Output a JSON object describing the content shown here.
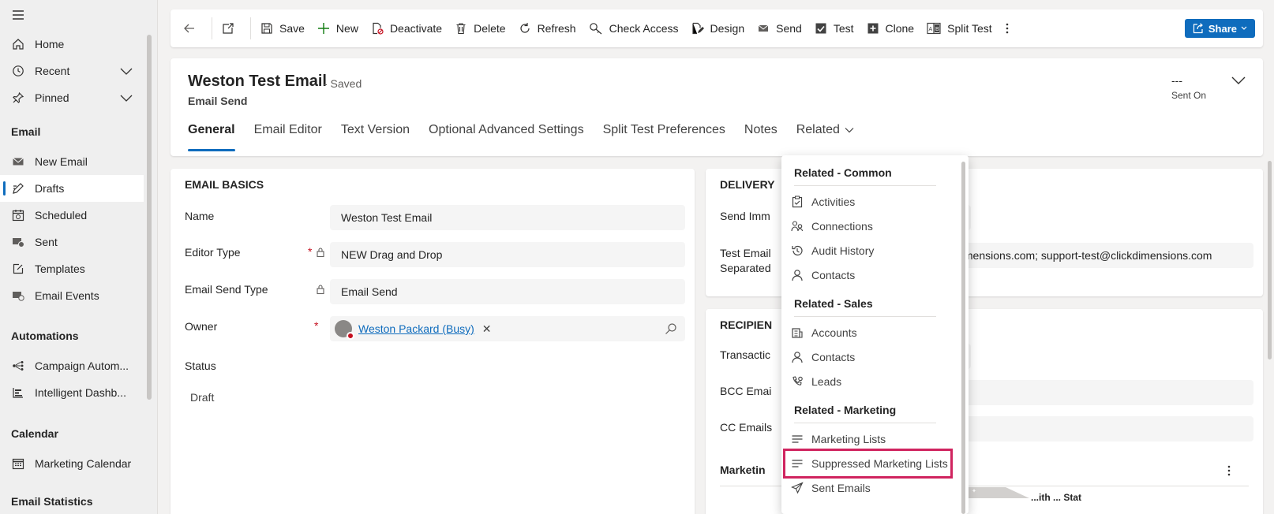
{
  "sidebar": {
    "nav": [
      {
        "label": "Home",
        "icon": "home-icon"
      },
      {
        "label": "Recent",
        "icon": "clock-icon"
      },
      {
        "label": "Pinned",
        "icon": "pin-icon"
      }
    ],
    "sections": [
      {
        "title": "Email",
        "items": [
          {
            "label": "New Email",
            "icon": "envelope-icon"
          },
          {
            "label": "Drafts",
            "icon": "pencil-icon"
          },
          {
            "label": "Scheduled",
            "icon": "calendar-clock-icon"
          },
          {
            "label": "Sent",
            "icon": "sent-icon"
          },
          {
            "label": "Templates",
            "icon": "template-icon"
          },
          {
            "label": "Email Events",
            "icon": "events-icon"
          }
        ]
      },
      {
        "title": "Automations",
        "items": [
          {
            "label": "Campaign Autom...",
            "icon": "flow-icon"
          },
          {
            "label": "Intelligent Dashb...",
            "icon": "dashboard-icon"
          }
        ]
      },
      {
        "title": "Calendar",
        "items": [
          {
            "label": "Marketing Calendar",
            "icon": "calendar-icon"
          }
        ]
      },
      {
        "title": "Email Statistics",
        "items": []
      }
    ],
    "active_item": "Drafts"
  },
  "toolbar": {
    "buttons": [
      "Save",
      "New",
      "Deactivate",
      "Delete",
      "Refresh",
      "Check Access",
      "Design",
      "Send",
      "Test",
      "Clone",
      "Split Test"
    ],
    "share_label": "Share"
  },
  "record": {
    "title": "Weston Test Email",
    "saved_status": "- Saved",
    "entity": "Email Send",
    "sent_on_value": "---",
    "sent_on_label": "Sent On"
  },
  "tabs": [
    "General",
    "Email Editor",
    "Text Version",
    "Optional Advanced Settings",
    "Split Test Preferences",
    "Notes",
    "Related"
  ],
  "basics": {
    "title": "EMAIL BASICS",
    "name_label": "Name",
    "name_value": "Weston Test Email",
    "editor_label": "Editor Type",
    "editor_value": "NEW Drag and Drop",
    "send_type_label": "Email Send Type",
    "send_type_value": "Email Send",
    "owner_label": "Owner",
    "owner_value": "Weston Packard (Busy)",
    "status_label": "Status",
    "status_value": "Draft",
    "required_mark": "*"
  },
  "delivery": {
    "title": "DELIVERY",
    "send_imm_label": "Send Imm",
    "test_email_label": "Test Email",
    "separated_label": "Separated",
    "test_email_value": "ckdimensions.com; support-test@clickdimensions.com"
  },
  "recipients": {
    "title": "RECIPIEN",
    "transaction_label": "Transactic",
    "bcc_label": "BCC Emai",
    "cc_label": "CC Emails",
    "marketing_label": "Marketin",
    "partial_header": "...ith ... Stat"
  },
  "related_menu": {
    "groups": [
      {
        "title": "Related - Common",
        "items": [
          "Activities",
          "Connections",
          "Audit History",
          "Contacts"
        ]
      },
      {
        "title": "Related - Sales",
        "items": [
          "Accounts",
          "Contacts",
          "Leads"
        ]
      },
      {
        "title": "Related - Marketing",
        "items": [
          "Marketing Lists",
          "Suppressed Marketing Lists",
          "Sent Emails"
        ]
      }
    ],
    "highlighted": "Suppressed Marketing Lists"
  },
  "colors": {
    "accent": "#0f6cbd",
    "highlight": "#d0245f",
    "required": "#c50f1f"
  }
}
